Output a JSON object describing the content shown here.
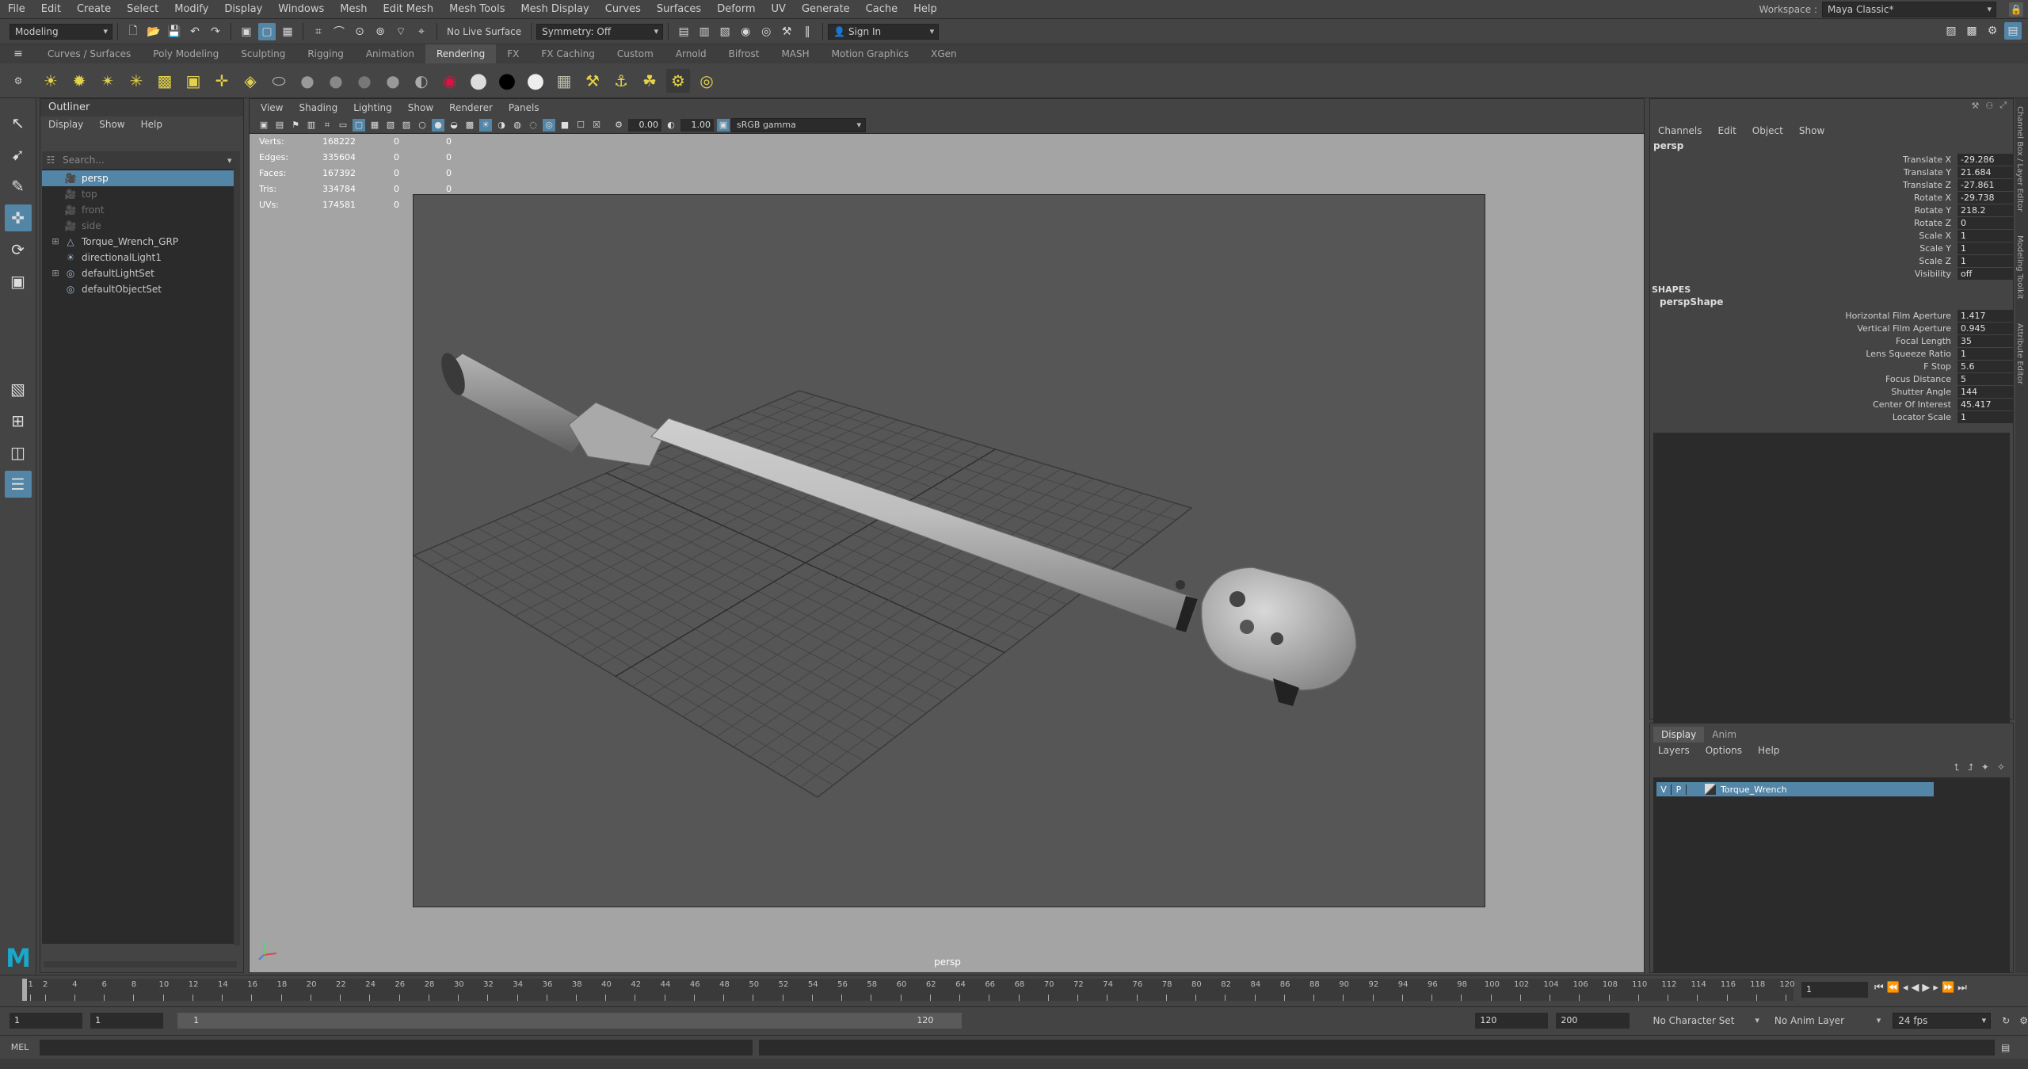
{
  "menubar": {
    "items": [
      "File",
      "Edit",
      "Create",
      "Select",
      "Modify",
      "Display",
      "Windows",
      "Mesh",
      "Edit Mesh",
      "Mesh Tools",
      "Mesh Display",
      "Curves",
      "Surfaces",
      "Deform",
      "UV",
      "Generate",
      "Cache",
      "Help"
    ],
    "workspace_label": "Workspace :",
    "workspace_value": "Maya Classic*"
  },
  "statusline": {
    "mode": "Modeling",
    "live_surface": "No Live Surface",
    "symmetry": "Symmetry: Off",
    "sign_in": "Sign In"
  },
  "shelf": {
    "tabs": [
      "Curves / Surfaces",
      "Poly Modeling",
      "Sculpting",
      "Rigging",
      "Animation",
      "Rendering",
      "FX",
      "FX Caching",
      "Custom",
      "Arnold",
      "Bifrost",
      "MASH",
      "Motion Graphics",
      "XGen"
    ],
    "active_tab": "Rendering"
  },
  "outliner": {
    "title": "Outliner",
    "menus": [
      "Display",
      "Show",
      "Help"
    ],
    "search_placeholder": "Search...",
    "items": [
      {
        "label": "persp",
        "icon": "camera-icon",
        "state": "selected"
      },
      {
        "label": "top",
        "icon": "camera-icon",
        "state": "hidden"
      },
      {
        "label": "front",
        "icon": "camera-icon",
        "state": "hidden"
      },
      {
        "label": "side",
        "icon": "camera-icon",
        "state": "hidden"
      },
      {
        "label": "Torque_Wrench_GRP",
        "icon": "group-icon",
        "state": "normal",
        "expandable": true
      },
      {
        "label": "directionalLight1",
        "icon": "light-icon",
        "state": "normal"
      },
      {
        "label": "defaultLightSet",
        "icon": "set-icon",
        "state": "normal",
        "expandable": true
      },
      {
        "label": "defaultObjectSet",
        "icon": "set-icon",
        "state": "normal"
      }
    ]
  },
  "viewport": {
    "menus": [
      "View",
      "Shading",
      "Lighting",
      "Show",
      "Renderer",
      "Panels"
    ],
    "exposure": "0.00",
    "gamma": "1.00",
    "color_space": "sRGB gamma",
    "camera_label": "persp",
    "hud": [
      {
        "label": "Verts:",
        "v1": "168222",
        "v2": "0",
        "v3": "0"
      },
      {
        "label": "Edges:",
        "v1": "335604",
        "v2": "0",
        "v3": "0"
      },
      {
        "label": "Faces:",
        "v1": "167392",
        "v2": "0",
        "v3": "0"
      },
      {
        "label": "Tris:",
        "v1": "334784",
        "v2": "0",
        "v3": "0"
      },
      {
        "label": "UVs:",
        "v1": "174581",
        "v2": "0",
        "v3": "0"
      }
    ]
  },
  "channelbox": {
    "menus": [
      "Channels",
      "Edit",
      "Object",
      "Show"
    ],
    "object": "persp",
    "channels": [
      {
        "name": "Translate X",
        "value": "-29.286"
      },
      {
        "name": "Translate Y",
        "value": "21.684"
      },
      {
        "name": "Translate Z",
        "value": "-27.861"
      },
      {
        "name": "Rotate X",
        "value": "-29.738"
      },
      {
        "name": "Rotate Y",
        "value": "218.2"
      },
      {
        "name": "Rotate Z",
        "value": "0"
      },
      {
        "name": "Scale X",
        "value": "1"
      },
      {
        "name": "Scale Y",
        "value": "1"
      },
      {
        "name": "Scale Z",
        "value": "1"
      },
      {
        "name": "Visibility",
        "value": "off"
      }
    ],
    "shapes_label": "SHAPES",
    "shape_name": "perspShape",
    "shape_channels": [
      {
        "name": "Horizontal Film Aperture",
        "value": "1.417"
      },
      {
        "name": "Vertical Film Aperture",
        "value": "0.945"
      },
      {
        "name": "Focal Length",
        "value": "35"
      },
      {
        "name": "Lens Squeeze Ratio",
        "value": "1"
      },
      {
        "name": "F Stop",
        "value": "5.6"
      },
      {
        "name": "Focus Distance",
        "value": "5"
      },
      {
        "name": "Shutter Angle",
        "value": "144"
      },
      {
        "name": "Center Of Interest",
        "value": "45.417"
      },
      {
        "name": "Locator Scale",
        "value": "1"
      }
    ]
  },
  "layereditor": {
    "tabs": [
      "Display",
      "Anim"
    ],
    "menus": [
      "Layers",
      "Options",
      "Help"
    ],
    "layer": {
      "v": "V",
      "p": "P",
      "name": "Torque_Wrench"
    }
  },
  "right_tabs": [
    "Channel Box / Layer Editor",
    "Modeling Toolkit",
    "Attribute Editor"
  ],
  "timeslider": {
    "ticks": [
      "1",
      "2",
      "4",
      "6",
      "8",
      "10",
      "12",
      "14",
      "16",
      "18",
      "20",
      "22",
      "24",
      "26",
      "28",
      "30",
      "32",
      "34",
      "36",
      "38",
      "40",
      "42",
      "44",
      "46",
      "48",
      "50",
      "52",
      "54",
      "56",
      "58",
      "60",
      "62",
      "64",
      "66",
      "68",
      "70",
      "72",
      "74",
      "76",
      "78",
      "80",
      "82",
      "84",
      "86",
      "88",
      "90",
      "92",
      "94",
      "96",
      "98",
      "100",
      "102",
      "104",
      "106",
      "108",
      "110",
      "112",
      "114",
      "116",
      "118",
      "120"
    ],
    "current_frame": "1"
  },
  "rangeslider": {
    "start": "1",
    "playback_start": "1",
    "range_start": "1",
    "range_end": "120",
    "playback_end": "120",
    "end": "200",
    "character_set": "No Character Set",
    "anim_layer": "No Anim Layer",
    "fps": "24 fps"
  },
  "cmdline": {
    "label": "MEL"
  },
  "colors": {
    "accent": "#5285a6",
    "panel": "#444444",
    "field": "#2b2b2b",
    "viewport_bg": "#a4a4a4",
    "gate": "#565656"
  }
}
